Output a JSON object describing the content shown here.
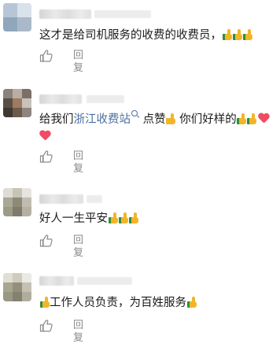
{
  "comments": [
    {
      "text": "这才是给司机服务的收费的收费员，",
      "thumbs": 3,
      "reply_label": "回复"
    },
    {
      "text_before_topic": "给我们",
      "topic_link": "浙江收费站",
      "topic_icon": "search-icon",
      "text_after_topic": " 点赞",
      "text_after_thumb": " 你们好样的",
      "reply_label": "回复"
    },
    {
      "text": "好人一生平安",
      "thumbs": 3,
      "reply_label": "回复"
    },
    {
      "text": "工作人员负责，为百姓服务",
      "reply_label": "回复"
    }
  ],
  "colors": {
    "link": "#4a6fa0",
    "secondary_text": "#8a8a8a",
    "thumb_emoji": "#f2b52a",
    "heart_emoji": "#ee4c62"
  }
}
